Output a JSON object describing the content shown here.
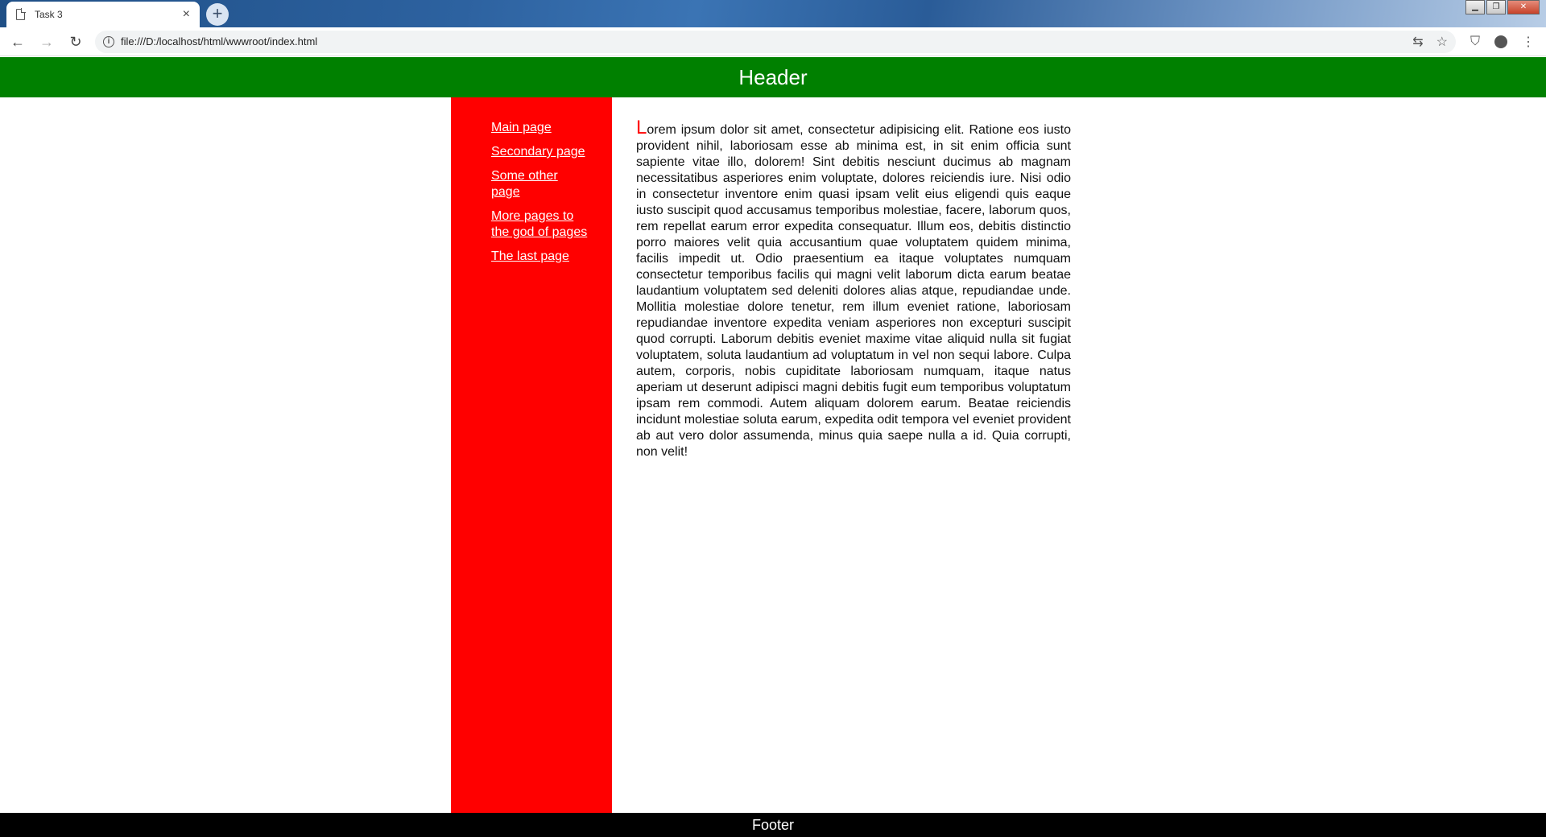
{
  "browser": {
    "tab_title": "Task 3",
    "tab_close": "×",
    "new_tab": "+",
    "url": "file:///D:/localhost/html/wwwroot/index.html",
    "back": "←",
    "forward": "→",
    "reload": "↻",
    "translate": "⇆",
    "star": "☆",
    "extension": "⛉",
    "menu": "⋮",
    "win_minimize": "▁",
    "win_restore": "❐",
    "win_close": "✕"
  },
  "page": {
    "header": "Header",
    "footer": "Footer",
    "nav": [
      {
        "label": "Main page"
      },
      {
        "label": "Secondary page"
      },
      {
        "label": "Some other page"
      },
      {
        "label": "More pages to the god of pages"
      },
      {
        "label": "The last page"
      }
    ],
    "content_first_letter": "L",
    "content_rest": "orem ipsum dolor sit amet, consectetur adipisicing elit. Ratione eos iusto provident nihil, laboriosam esse ab minima est, in sit enim officia sunt sapiente vitae illo, dolorem! Sint debitis nesciunt ducimus ab magnam necessitatibus asperiores enim voluptate, dolores reiciendis iure. Nisi odio in consectetur inventore enim quasi ipsam velit eius eligendi quis eaque iusto suscipit quod accusamus temporibus molestiae, facere, laborum quos, rem repellat earum error expedita consequatur. Illum eos, debitis distinctio porro maiores velit quia accusantium quae voluptatem quidem minima, facilis impedit ut. Odio praesentium ea itaque voluptates numquam consectetur temporibus facilis qui magni velit laborum dicta earum beatae laudantium voluptatem sed deleniti dolores alias atque, repudiandae unde. Mollitia molestiae dolore tenetur, rem illum eveniet ratione, laboriosam repudiandae inventore expedita veniam asperiores non excepturi suscipit quod corrupti. Laborum debitis eveniet maxime vitae aliquid nulla sit fugiat voluptatem, soluta laudantium ad voluptatum in vel non sequi labore. Culpa autem, corporis, nobis cupiditate laboriosam numquam, itaque natus aperiam ut deserunt adipisci magni debitis fugit eum temporibus voluptatum ipsam rem commodi. Autem aliquam dolorem earum. Beatae reiciendis incidunt molestiae soluta earum, expedita odit tempora vel eveniet provident ab aut vero dolor assumenda, minus quia saepe nulla a id. Quia corrupti, non velit!"
  },
  "colors": {
    "header_bg": "#008000",
    "sidebar_bg": "#ff0000",
    "footer_bg": "#000000",
    "accent_letter": "#ff0000"
  }
}
